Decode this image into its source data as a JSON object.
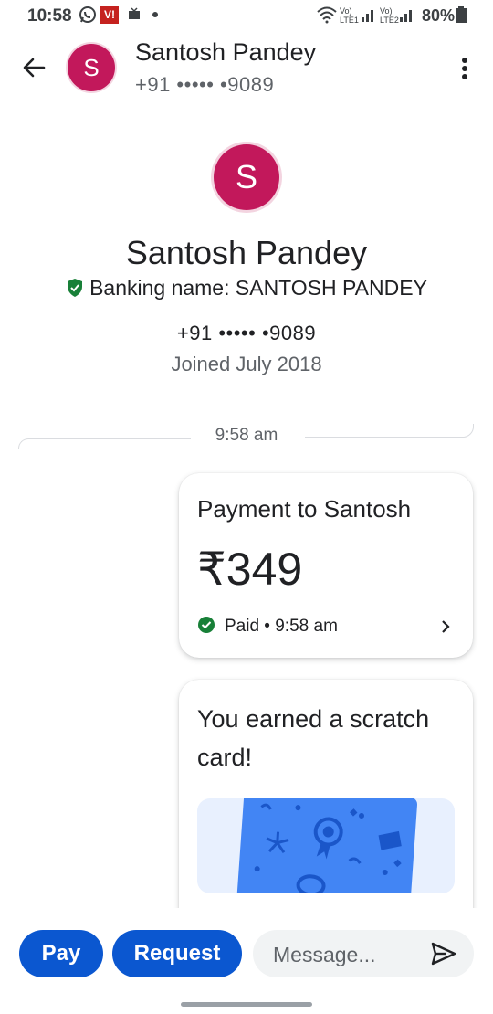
{
  "status_bar": {
    "time": "10:58",
    "app_badge": "V!",
    "network_1": "Vo) LTE1",
    "network_2": "Vo) LTE2",
    "battery": "80%"
  },
  "header": {
    "avatar_letter": "S",
    "name": "Santosh Pandey",
    "phone": "+91 ••••• •9089",
    "back_icon": "arrow-left-icon",
    "more_icon": "more-vert-icon"
  },
  "profile": {
    "avatar_letter": "S",
    "name": "Santosh Pandey",
    "banking_name": "Banking name: SANTOSH PANDEY",
    "phone": "+91 ••••• •9089",
    "joined": "Joined July 2018"
  },
  "timeline": {
    "time": "9:58 am"
  },
  "payment_card": {
    "title": "Payment to Santosh",
    "amount": "₹349",
    "status": "Paid • 9:58 am"
  },
  "scratch_card": {
    "title": "You earned a scratch card!"
  },
  "bottom_bar": {
    "pay_label": "Pay",
    "request_label": "Request",
    "message_placeholder": "Message..."
  },
  "colors": {
    "avatar": "#c2185b",
    "accent": "#0b57d0",
    "verified_green": "#188038",
    "scratch_blue": "#4285f4"
  }
}
